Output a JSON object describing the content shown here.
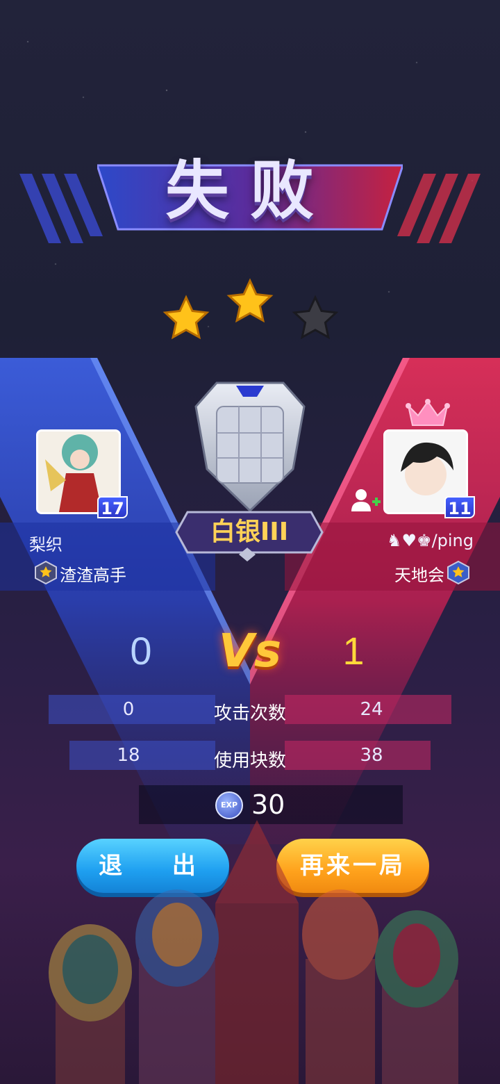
{
  "result": {
    "title": "失败"
  },
  "stars": {
    "earned": 2,
    "total": 3
  },
  "rank": {
    "label": "白银III"
  },
  "vs_label": "Vs",
  "player_left": {
    "name": "梨织",
    "level": "17",
    "clan": "渣渣高手",
    "score": "0",
    "attack_count": "0",
    "blocks_used": "18"
  },
  "player_right": {
    "name": "♞♥♚/ping",
    "level": "11",
    "clan": "天地会",
    "score": "1",
    "attack_count": "24",
    "blocks_used": "38"
  },
  "stats": {
    "attack_label": "攻击次数",
    "blocks_label": "使用块数"
  },
  "exp": {
    "icon_text": "EXP",
    "value": "30"
  },
  "buttons": {
    "exit": "退 出",
    "play_again": "再来一局"
  },
  "colors": {
    "left_team": "#3a56d8",
    "right_team": "#e2345e",
    "star_gold": "#ffc21a",
    "star_empty": "#3c3c44",
    "score_left": "#b9d4ff",
    "score_right": "#ffd93a"
  }
}
